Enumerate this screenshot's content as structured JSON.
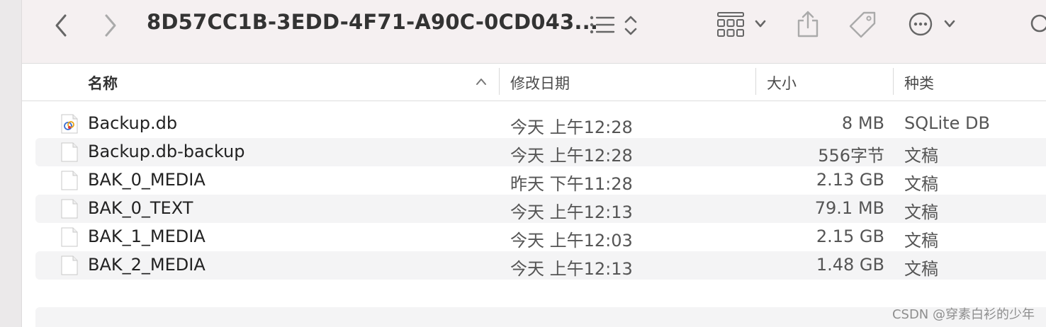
{
  "window": {
    "title": "8D57CC1B-3EDD-4F71-A90C-0CD043..."
  },
  "toolbar": {
    "icons": [
      "chevron-left-icon",
      "chevron-right-icon",
      "list-view-icon",
      "sort-updown-icon",
      "grid-view-icon",
      "chevron-down-icon",
      "share-icon",
      "tag-icon",
      "more-icon",
      "chevron-down-icon",
      "search-icon"
    ]
  },
  "columns": {
    "name": "名称",
    "date": "修改日期",
    "size": "大小",
    "kind": "种类"
  },
  "files": [
    {
      "name": "Backup.db",
      "date": "今天 上午12:28",
      "size": "8 MB",
      "kind": "SQLite DB",
      "icon": "sqlite-file-icon"
    },
    {
      "name": "Backup.db-backup",
      "date": "今天 上午12:28",
      "size": "556字节",
      "kind": "文稿",
      "icon": "document-icon"
    },
    {
      "name": "BAK_0_MEDIA",
      "date": "昨天 下午11:28",
      "size": "2.13 GB",
      "kind": "文稿",
      "icon": "document-icon"
    },
    {
      "name": "BAK_0_TEXT",
      "date": "今天 上午12:13",
      "size": "79.1 MB",
      "kind": "文稿",
      "icon": "document-icon"
    },
    {
      "name": "BAK_1_MEDIA",
      "date": "今天 上午12:03",
      "size": "2.15 GB",
      "kind": "文稿",
      "icon": "document-icon"
    },
    {
      "name": "BAK_2_MEDIA",
      "date": "今天 上午12:13",
      "size": "1.48 GB",
      "kind": "文稿",
      "icon": "document-icon"
    }
  ],
  "watermark": "CSDN @穿素白衫的少年",
  "colors": {
    "toolbar_bg": "#f5f0f1",
    "stripe": "#f4f4f5",
    "icon_gray": "#666666"
  }
}
